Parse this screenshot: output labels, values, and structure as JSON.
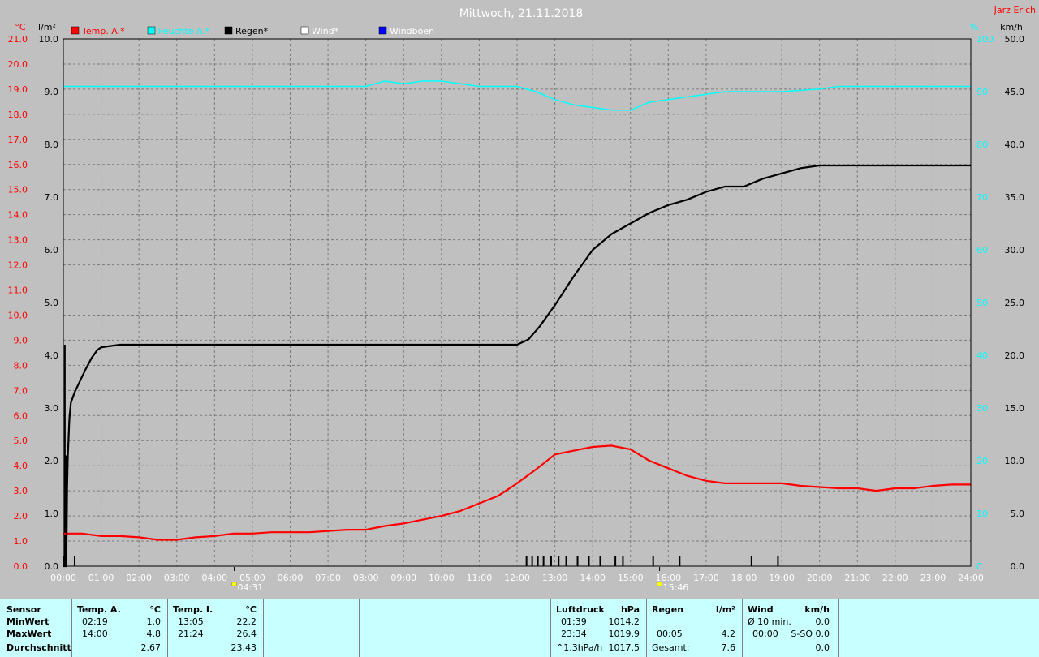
{
  "header": {
    "title": "Mittwoch, 21.11.2018",
    "author": "Jarz Erich"
  },
  "legend": [
    {
      "label": "Temp. A.*",
      "color": "#ff0000"
    },
    {
      "label": "Feuchte A.*",
      "color": "#00ffff"
    },
    {
      "label": "Regen*",
      "color": "#000000"
    },
    {
      "label": "Wind*",
      "color": "#ffffff"
    },
    {
      "label": "Windböen",
      "color": "#0000ff"
    }
  ],
  "axis_units": {
    "temp": "°C",
    "rain": "l/m²",
    "humidity": "%",
    "wind": "km/h"
  },
  "axis_ticks": {
    "temp": [
      "0.0",
      "1.0",
      "2.0",
      "3.0",
      "4.0",
      "5.0",
      "6.0",
      "7.0",
      "8.0",
      "9.0",
      "10.0",
      "11.0",
      "12.0",
      "13.0",
      "14.0",
      "15.0",
      "16.0",
      "17.0",
      "18.0",
      "19.0",
      "20.0",
      "21.0"
    ],
    "rain": [
      "0.0",
      "1.0",
      "2.0",
      "3.0",
      "4.0",
      "5.0",
      "6.0",
      "7.0",
      "8.0",
      "9.0",
      "10.0"
    ],
    "humidity": [
      "0",
      "10",
      "20",
      "30",
      "40",
      "50",
      "60",
      "70",
      "80",
      "90",
      "100"
    ],
    "wind": [
      "0.0",
      "5.0",
      "10.0",
      "15.0",
      "20.0",
      "25.0",
      "30.0",
      "35.0",
      "40.0",
      "45.0",
      "50.0"
    ],
    "time": [
      "00:00",
      "01:00",
      "02:00",
      "03:00",
      "04:00",
      "05:00",
      "06:00",
      "07:00",
      "08:00",
      "09:00",
      "10:00",
      "11:00",
      "12:00",
      "13:00",
      "14:00",
      "15:00",
      "16:00",
      "17:00",
      "18:00",
      "19:00",
      "20:00",
      "21:00",
      "22:00",
      "23:00",
      "24:00"
    ]
  },
  "sun_markers": [
    {
      "time": "04:31",
      "hour": 4.52
    },
    {
      "time": "15:46",
      "hour": 15.77
    }
  ],
  "chart_data": {
    "type": "line",
    "title": "Mittwoch, 21.11.2018",
    "x_unit": "hour of day",
    "xlim": [
      0,
      24
    ],
    "axes": {
      "temp": {
        "range": [
          0,
          21
        ],
        "unit": "°C"
      },
      "rain": {
        "range": [
          0,
          10
        ],
        "unit": "l/m²"
      },
      "humidity": {
        "range": [
          0,
          100
        ],
        "unit": "%"
      },
      "wind": {
        "range": [
          0,
          50
        ],
        "unit": "km/h"
      }
    },
    "grid": true,
    "series": [
      {
        "name": "Temp. A.*",
        "axis": "temp",
        "color": "#ff0000",
        "points": [
          [
            0,
            1.3
          ],
          [
            0.5,
            1.3
          ],
          [
            1,
            1.2
          ],
          [
            1.5,
            1.2
          ],
          [
            2,
            1.15
          ],
          [
            2.5,
            1.05
          ],
          [
            3,
            1.05
          ],
          [
            3.5,
            1.15
          ],
          [
            4,
            1.2
          ],
          [
            4.5,
            1.3
          ],
          [
            5,
            1.3
          ],
          [
            5.5,
            1.35
          ],
          [
            6,
            1.35
          ],
          [
            6.5,
            1.35
          ],
          [
            7,
            1.4
          ],
          [
            7.5,
            1.45
          ],
          [
            8,
            1.45
          ],
          [
            8.5,
            1.6
          ],
          [
            9,
            1.7
          ],
          [
            9.5,
            1.85
          ],
          [
            10,
            2.0
          ],
          [
            10.5,
            2.2
          ],
          [
            11,
            2.5
          ],
          [
            11.5,
            2.8
          ],
          [
            12,
            3.3
          ],
          [
            12.5,
            3.85
          ],
          [
            13,
            4.45
          ],
          [
            13.5,
            4.6
          ],
          [
            14,
            4.75
          ],
          [
            14.5,
            4.8
          ],
          [
            15,
            4.65
          ],
          [
            15.5,
            4.2
          ],
          [
            16,
            3.9
          ],
          [
            16.5,
            3.6
          ],
          [
            17,
            3.4
          ],
          [
            17.5,
            3.3
          ],
          [
            18,
            3.3
          ],
          [
            18.5,
            3.3
          ],
          [
            19,
            3.3
          ],
          [
            19.5,
            3.2
          ],
          [
            20,
            3.15
          ],
          [
            20.5,
            3.1
          ],
          [
            21,
            3.1
          ],
          [
            21.5,
            3.0
          ],
          [
            22,
            3.1
          ],
          [
            22.5,
            3.1
          ],
          [
            23,
            3.2
          ],
          [
            23.5,
            3.25
          ],
          [
            24,
            3.25
          ]
        ]
      },
      {
        "name": "Feuchte A.*",
        "axis": "humidity",
        "color": "#00ffff",
        "points": [
          [
            0,
            91
          ],
          [
            1,
            91
          ],
          [
            2,
            91
          ],
          [
            3,
            91
          ],
          [
            4,
            91
          ],
          [
            5,
            91
          ],
          [
            6,
            91
          ],
          [
            7,
            91
          ],
          [
            8,
            91
          ],
          [
            8.5,
            92
          ],
          [
            9,
            91.5
          ],
          [
            9.5,
            92
          ],
          [
            10,
            92
          ],
          [
            10.5,
            91.5
          ],
          [
            11,
            91
          ],
          [
            12,
            91
          ],
          [
            12.5,
            90
          ],
          [
            13,
            88.5
          ],
          [
            13.5,
            87.5
          ],
          [
            14,
            87
          ],
          [
            14.5,
            86.5
          ],
          [
            15,
            86.5
          ],
          [
            15.5,
            88
          ],
          [
            16,
            88.5
          ],
          [
            16.5,
            89
          ],
          [
            17,
            89.5
          ],
          [
            17.5,
            90
          ],
          [
            18,
            90
          ],
          [
            19,
            90
          ],
          [
            20,
            90.5
          ],
          [
            20.5,
            91
          ],
          [
            21,
            91
          ],
          [
            22,
            91
          ],
          [
            23,
            91
          ],
          [
            24,
            91
          ]
        ]
      },
      {
        "name": "Regen*",
        "axis": "rain",
        "color": "#000000",
        "points": [
          [
            0,
            0
          ],
          [
            0.08,
            0
          ],
          [
            0.1,
            1.5
          ],
          [
            0.12,
            2.1
          ],
          [
            0.16,
            2.8
          ],
          [
            0.2,
            3.1
          ],
          [
            0.3,
            3.3
          ],
          [
            0.4,
            3.45
          ],
          [
            0.5,
            3.6
          ],
          [
            0.6,
            3.75
          ],
          [
            0.75,
            3.95
          ],
          [
            0.9,
            4.1
          ],
          [
            1.0,
            4.15
          ],
          [
            1.2,
            4.17
          ],
          [
            1.5,
            4.2
          ],
          [
            2,
            4.2
          ],
          [
            12,
            4.2
          ],
          [
            12.3,
            4.3
          ],
          [
            12.6,
            4.55
          ],
          [
            13,
            4.95
          ],
          [
            13.5,
            5.5
          ],
          [
            14,
            6.0
          ],
          [
            14.5,
            6.3
          ],
          [
            15,
            6.5
          ],
          [
            15.5,
            6.7
          ],
          [
            16,
            6.85
          ],
          [
            16.5,
            6.95
          ],
          [
            17,
            7.1
          ],
          [
            17.5,
            7.2
          ],
          [
            18,
            7.2
          ],
          [
            18.5,
            7.35
          ],
          [
            19,
            7.45
          ],
          [
            19.5,
            7.55
          ],
          [
            20,
            7.6
          ],
          [
            24,
            7.6
          ]
        ]
      }
    ],
    "rain_ticks": [
      0.03,
      0.08,
      0.3,
      12.25,
      12.4,
      12.55,
      12.7,
      12.9,
      13.1,
      13.3,
      13.6,
      13.9,
      14.2,
      14.6,
      14.8,
      15.6,
      16.3,
      18.2,
      18.9
    ],
    "rain_intensity_spikes": [
      [
        0.04,
        4.2
      ],
      [
        0.07,
        2.1
      ]
    ]
  },
  "stats": {
    "headers": {
      "sensor": "Sensor",
      "temp_a": "Temp. A.",
      "temp_i": "Temp. I.",
      "pressure": "Luftdruck",
      "rain": "Regen",
      "wind": "Wind"
    },
    "units": {
      "temp_a": "°C",
      "temp_i": "°C",
      "pressure": "hPa",
      "rain": "l/m²",
      "wind": "km/h"
    },
    "rows": [
      "MinWert",
      "MaxWert",
      "Durchschnitt"
    ],
    "temp_a": [
      [
        "02:19",
        "1.0"
      ],
      [
        "14:00",
        "4.8"
      ],
      [
        "",
        "2.67"
      ]
    ],
    "temp_i": [
      [
        "13:05",
        "22.2"
      ],
      [
        "21:24",
        "26.4"
      ],
      [
        "",
        "23.43"
      ]
    ],
    "pressure": [
      [
        "01:39",
        "1014.2"
      ],
      [
        "23:34",
        "1019.9"
      ],
      [
        "^1.3hPa/h",
        "1017.5"
      ]
    ],
    "rain": [
      [
        "",
        ""
      ],
      [
        "00:05",
        "4.2"
      ],
      [
        "Gesamt:",
        "7.6"
      ]
    ],
    "wind": [
      [
        "Ø 10 min.",
        "0.0"
      ],
      [
        "00:00",
        "S-SO 0.0"
      ],
      [
        "",
        "0.0"
      ]
    ]
  }
}
